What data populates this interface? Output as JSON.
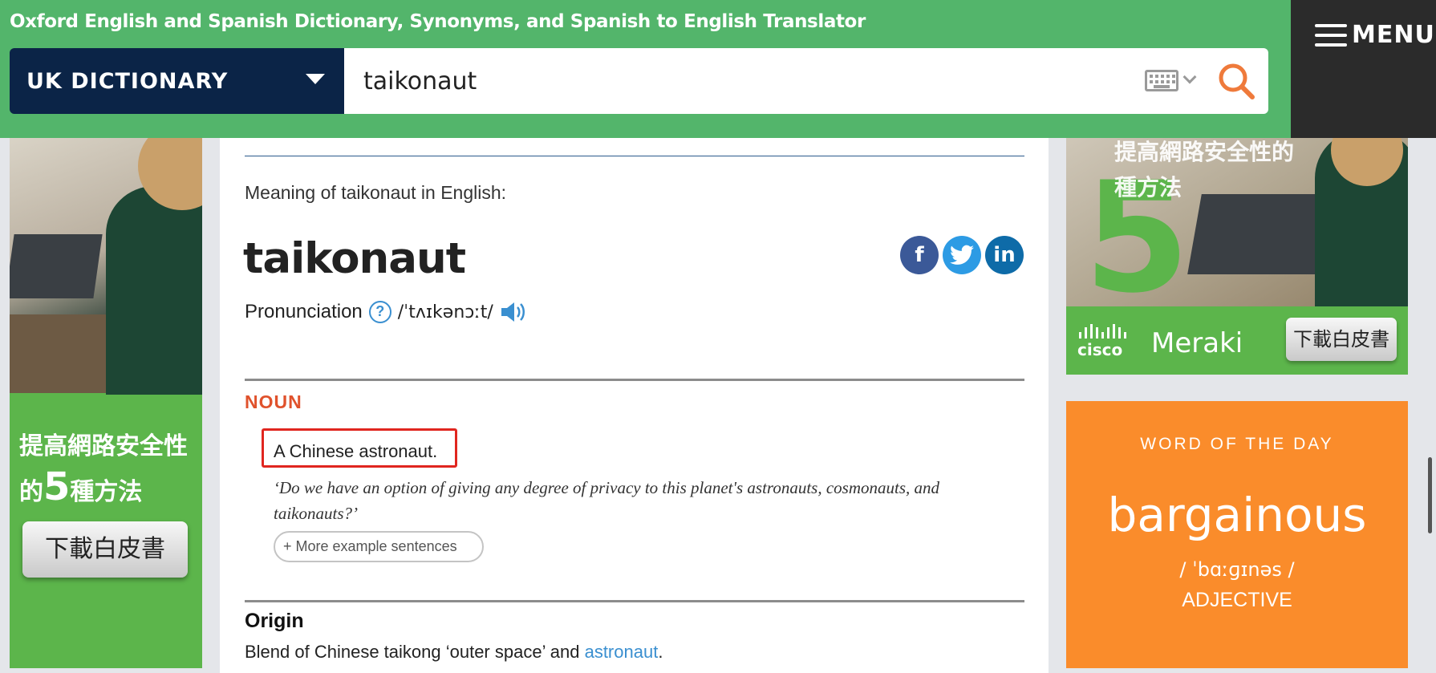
{
  "header": {
    "site_title": "Oxford English and Spanish Dictionary, Synonyms, and Spanish to English Translator",
    "dictionary_select": "UK DICTIONARY",
    "search_value": "taikonaut",
    "menu_label": "MENU",
    "accent_color": "#53b56b"
  },
  "ads": {
    "left_text_1": "提高網路安全性",
    "left_text_2_prefix": "的",
    "left_text_2_num": "5",
    "left_text_2_suffix": "種方法",
    "left_button": "下載白皮書",
    "right_headline_1": "提高網路安全性的",
    "right_headline_2": "種方法",
    "right_big_num": "5",
    "right_brand_1": "cisco",
    "right_brand_2": "Meraki",
    "right_button": "下載白皮書"
  },
  "entry": {
    "meaning_label": "Meaning of taikonaut in English:",
    "headword": "taikonaut",
    "pronunciation_label": "Pronunciation",
    "help_glyph": "?",
    "ipa": "/ˈtʌɪkənɔːt/",
    "pos": "NOUN",
    "definition": "A Chinese astronaut.",
    "example": "‘Do we have an option of giving any degree of privacy to this planet's astronauts, cosmonauts, and taikonauts?’",
    "more_examples": "+ More example sentences",
    "origin_heading": "Origin",
    "origin_prefix": "Blend of Chinese taikong ‘outer space’ and ",
    "origin_link": "astronaut",
    "origin_suffix": "."
  },
  "social": {
    "facebook": "f",
    "twitter": "🐦",
    "linkedin": "in",
    "facebook_color": "#3b5998",
    "twitter_color": "#2d9be4",
    "linkedin_color": "#0e6ba8"
  },
  "word_of_the_day": {
    "kicker": "WORD OF THE DAY",
    "word": "bargainous",
    "ipa": "/ ˈbɑːɡɪnəs /",
    "pos": "ADJECTIVE",
    "color": "#fa8c2b"
  }
}
